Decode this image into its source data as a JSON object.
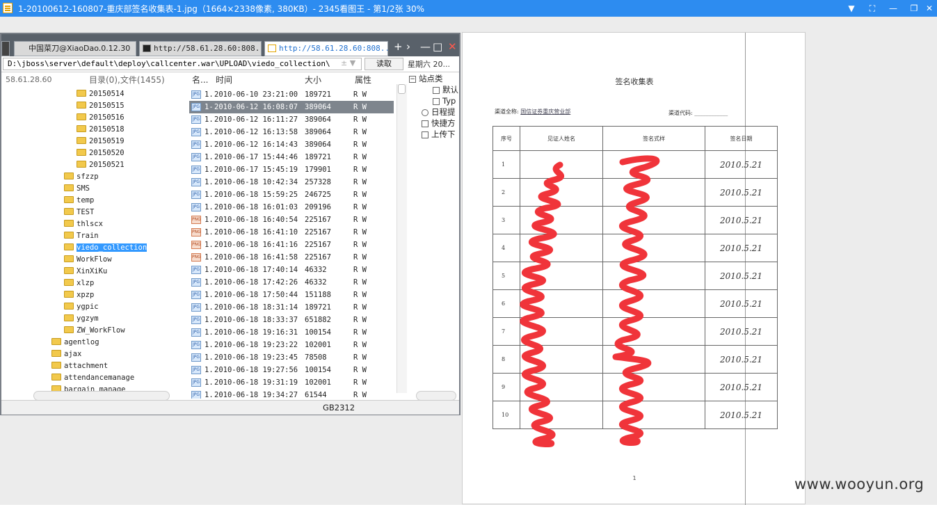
{
  "window": {
    "title": "1-20100612-160807-重庆部签名收集表-1.jpg（1664×2338像素, 380KB）- 2345看图王 - 第1/2张 30%"
  },
  "browser": {
    "tabs": [
      {
        "label": ""
      },
      {
        "label": "中国菜刀@XiaoDao.0.12.30"
      },
      {
        "label": "http://58.61.28.60:808..."
      },
      {
        "label": "http://58.61.28.60:808..."
      }
    ],
    "address": "D:\\jboss\\server\\default\\deploy\\callcenter.war\\UPLOAD\\viedo_collection\\",
    "address_extra": "± ▼",
    "read_button": "读取",
    "date_label": "星期六 20...",
    "server_ip": "58.61.28.60",
    "dir_summary": "目录(0),文件(1455)",
    "columns": {
      "name": "名...",
      "time": "时间",
      "size": "大小",
      "attr": "属性"
    },
    "tree": [
      {
        "label": "20150514",
        "level": 2
      },
      {
        "label": "20150515",
        "level": 2
      },
      {
        "label": "20150516",
        "level": 2
      },
      {
        "label": "20150518",
        "level": 2
      },
      {
        "label": "20150519",
        "level": 2
      },
      {
        "label": "20150520",
        "level": 2
      },
      {
        "label": "20150521",
        "level": 2
      },
      {
        "label": "sfzzp",
        "level": 1
      },
      {
        "label": "SMS",
        "level": 1
      },
      {
        "label": "temp",
        "level": 1
      },
      {
        "label": "TEST",
        "level": 1
      },
      {
        "label": "thlscx",
        "level": 1
      },
      {
        "label": "Train",
        "level": 1
      },
      {
        "label": "viedo_collection",
        "level": 1,
        "selected": true
      },
      {
        "label": "WorkFlow",
        "level": 1
      },
      {
        "label": "XinXiKu",
        "level": 1
      },
      {
        "label": "xlzp",
        "level": 1
      },
      {
        "label": "xpzp",
        "level": 1
      },
      {
        "label": "ygpic",
        "level": 1
      },
      {
        "label": "ygzym",
        "level": 1
      },
      {
        "label": "ZW_WorkFlow",
        "level": 1
      },
      {
        "label": "agentlog",
        "level": 0
      },
      {
        "label": "ajax",
        "level": 0
      },
      {
        "label": "attachment",
        "level": 0
      },
      {
        "label": "attendancemanage",
        "level": 0
      },
      {
        "label": "bargain_manage",
        "level": 0
      }
    ],
    "files": [
      {
        "type": "JPG",
        "name": "1.",
        "time": "2010-06-10 23:21:00",
        "size": "189721",
        "attr": "R W"
      },
      {
        "type": "JPG",
        "name": "1-",
        "time": "2010-06-12 16:08:07",
        "size": "389064",
        "attr": "R W",
        "selected": true
      },
      {
        "type": "JPG",
        "name": "1.",
        "time": "2010-06-12 16:11:27",
        "size": "389064",
        "attr": "R W"
      },
      {
        "type": "JPG",
        "name": "1.",
        "time": "2010-06-12 16:13:58",
        "size": "389064",
        "attr": "R W"
      },
      {
        "type": "JPG",
        "name": "1.",
        "time": "2010-06-12 16:14:43",
        "size": "389064",
        "attr": "R W"
      },
      {
        "type": "JPG",
        "name": "1.",
        "time": "2010-06-17 15:44:46",
        "size": "189721",
        "attr": "R W"
      },
      {
        "type": "JPG",
        "name": "1.",
        "time": "2010-06-17 15:45:19",
        "size": "179901",
        "attr": "R W"
      },
      {
        "type": "JPG",
        "name": "1.",
        "time": "2010-06-18 10:42:34",
        "size": "257328",
        "attr": "R W"
      },
      {
        "type": "JPG",
        "name": "1.",
        "time": "2010-06-18 15:59:25",
        "size": "246725",
        "attr": "R W"
      },
      {
        "type": "JPG",
        "name": "1.",
        "time": "2010-06-18 16:01:03",
        "size": "209196",
        "attr": "R W"
      },
      {
        "type": "PNG",
        "name": "1.",
        "time": "2010-06-18 16:40:54",
        "size": "225167",
        "attr": "R W"
      },
      {
        "type": "PNG",
        "name": "1.",
        "time": "2010-06-18 16:41:10",
        "size": "225167",
        "attr": "R W"
      },
      {
        "type": "PNG",
        "name": "1.",
        "time": "2010-06-18 16:41:16",
        "size": "225167",
        "attr": "R W"
      },
      {
        "type": "PNG",
        "name": "1.",
        "time": "2010-06-18 16:41:58",
        "size": "225167",
        "attr": "R W"
      },
      {
        "type": "JPG",
        "name": "1.",
        "time": "2010-06-18 17:40:14",
        "size": "46332",
        "attr": "R W"
      },
      {
        "type": "JPG",
        "name": "1.",
        "time": "2010-06-18 17:42:26",
        "size": "46332",
        "attr": "R W"
      },
      {
        "type": "JPG",
        "name": "1.",
        "time": "2010-06-18 17:50:44",
        "size": "151188",
        "attr": "R W"
      },
      {
        "type": "JPG",
        "name": "1.",
        "time": "2010-06-18 18:31:14",
        "size": "189721",
        "attr": "R W"
      },
      {
        "type": "JPG",
        "name": "1.",
        "time": "2010-06-18 18:33:37",
        "size": "651882",
        "attr": "R W"
      },
      {
        "type": "JPG",
        "name": "1.",
        "time": "2010-06-18 19:16:31",
        "size": "100154",
        "attr": "R W"
      },
      {
        "type": "JPG",
        "name": "1.",
        "time": "2010-06-18 19:23:22",
        "size": "102001",
        "attr": "R W"
      },
      {
        "type": "JPG",
        "name": "1.",
        "time": "2010-06-18 19:23:45",
        "size": "78508",
        "attr": "R W"
      },
      {
        "type": "JPG",
        "name": "1.",
        "time": "2010-06-18 19:27:56",
        "size": "100154",
        "attr": "R W"
      },
      {
        "type": "JPG",
        "name": "1.",
        "time": "2010-06-18 19:31:19",
        "size": "102001",
        "attr": "R W"
      },
      {
        "type": "JPG",
        "name": "1.",
        "time": "2010-06-18 19:34:27",
        "size": "61544",
        "attr": "R W"
      }
    ],
    "right_panel": [
      {
        "label": "站点类",
        "kind": "expander"
      },
      {
        "label": "默认",
        "kind": "page"
      },
      {
        "label": "Typ",
        "kind": "page"
      },
      {
        "label": "日程提",
        "kind": "clock"
      },
      {
        "label": "快捷方",
        "kind": "hand"
      },
      {
        "label": "上传下",
        "kind": "box"
      }
    ],
    "encoding": "GB2312"
  },
  "document": {
    "title": "签名收集表",
    "channel_label": "渠道全称:",
    "channel_value": "国信证券重庆营业部",
    "code_label": "渠道代码: ____________",
    "headers": [
      "序号",
      "见证人姓名",
      "签名式样",
      "签名日期"
    ],
    "rows": [
      {
        "seq": "1",
        "date": "2010.5.21"
      },
      {
        "seq": "2",
        "date": "2010.5.21"
      },
      {
        "seq": "3",
        "date": "2010.5.21"
      },
      {
        "seq": "4",
        "date": "2010.5.21"
      },
      {
        "seq": "5",
        "date": "2010.5.21"
      },
      {
        "seq": "6",
        "date": "2010.5.21"
      },
      {
        "seq": "7",
        "date": "2010.5.21"
      },
      {
        "seq": "8",
        "date": "2010.5.21"
      },
      {
        "seq": "9",
        "date": "2010.5.21"
      },
      {
        "seq": "10",
        "date": "2010.5.21"
      }
    ],
    "page_number": "1",
    "redaction_color": "#f0343a"
  },
  "watermark": "www.wooyun.org"
}
